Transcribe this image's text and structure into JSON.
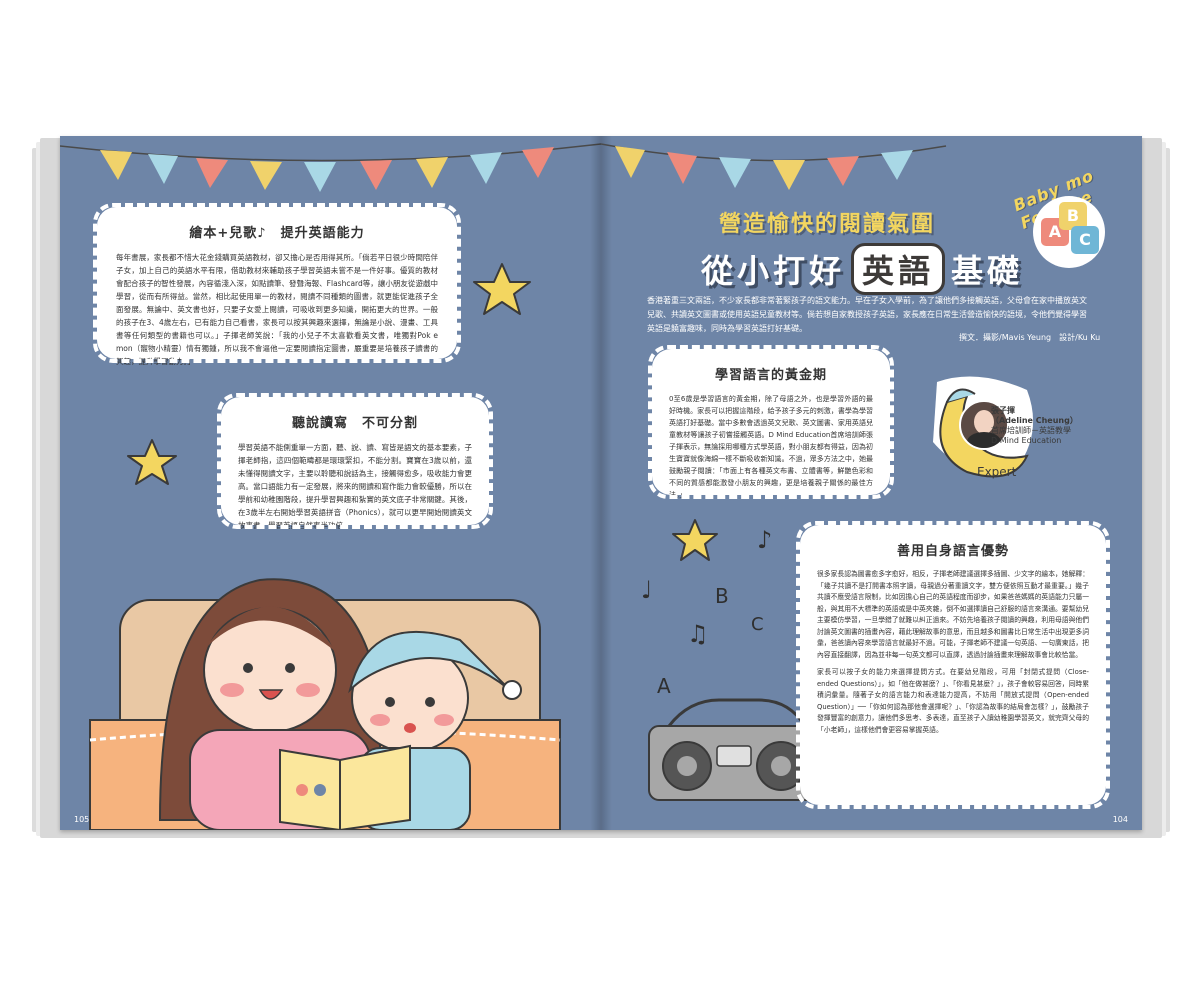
{
  "left_page": {
    "page_number": "105",
    "box1": {
      "title": "繪本+兒歌♪　提升英語能力",
      "text": "每年書展，家長都不惜大花金錢購買英語教材，卻又擔心是否用得其所。「倘若平日很少時間陪伴子女，加上自己的英語水平有限，借助教材來輔助孩子學習英語未嘗不是一件好事。優質的教材會配合孩子的智性發展，內容循淺入深，如點讀筆、發聲海報、Flashcard等，讓小朋友從遊戲中學習，從而有所得益。當然，相比起使用單一的教材，閱讀不同種類的圖書，就更能促進孩子全面發展。無論中、英文書也好，只要子女愛上閱讀，可吸收到更多知識，開拓更大的世界。一般的孩子在3、4歲左右，已有能力自己看書，家長可以按其興趣來選擇，無論是小說、漫畫、工具書等任何類型的書籍也可以。」子揮老師笑說：「我的小兒子不太喜歡看英文書，唯獨對Pok e mon（寵物小精靈）情有獨鍾，所以我不會逼他一定要閱讀指定圖書，嚴重要是培養孩子讀書的興趣，提升學習動力。」"
    },
    "box2": {
      "title": "聽說讀寫　不可分割",
      "text": "學習英語不能側重單一方面，聽、說、讀、寫皆是語文的基本要素，子揮老師指，這四個範疇都是環環緊扣，不能分割。寶寶在3歲以前，還未懂得閱讀文字，主要以聆聽和說話為主，接觸得愈多，吸收能力會更高。當口語能力有一定發展，將來的閱讀和寫作能力會較優勝，所以在學前和幼稚園階段，提升學習興趣和紮實的英文底子非常關鍵。其後，在3歲半左右開始學習英語拼音（Phonics），就可以更早開始閱讀英文故事書，學習英語自然事半功倍。"
    }
  },
  "right_page": {
    "page_number": "104",
    "feature_label": "Baby mo Feature",
    "abc_letters": [
      "A",
      "B",
      "C"
    ],
    "headline_line1": "營造愉快的閱讀氣圍",
    "headline_pre": "從小打好",
    "headline_highlight": "英語",
    "headline_post": "基礎",
    "intro": "香港著重三文兩語，不少家長都非常著緊孩子的語文能力。早在子女入學前，為了讓他們多接觸英語，父母會在家中播放英文兒歌、共讀英文圖書或使用英語兒童教材等。倘若想自家教授孩子英語，家長應在日常生活營造愉快的語境，令他們覺得學習英語是饒富趣味，同時為學習英語打好基礎。",
    "credit": "撰文．攝影/Mavis Yeung　設計/Ku Ku",
    "box3": {
      "title": "學習語言的黃金期",
      "text": "0至6歲是學習語言的黃金期，除了母語之外，也是學習外語的最好時機。家長可以把握這階段，給予孩子多元的刺激，書學為學習英語打好基礎。當中多數會透過英文兒歌、英文圖書、家用英語兒童教材等讓孩子初嘗接觸英語。D Mind Education首席培訓師張子揮表示，無論採用哪種方式學英語，對小朋友都有得益，因為初生寶寶就像海綿一樣不斷吸收新知識。不過，眾多方法之中，她最鼓勵親子閱讀：「市面上有各種英文布書、立體書等，鮮艷色彩和不同的質感都能激發小朋友的興趣，更是培養親子關係的最佳方法。」"
    },
    "expert": {
      "name": "張子揮",
      "name_en": "（Adeline Cheung）",
      "title": "首席培訓師－英語教學",
      "org": "D Mind Education",
      "badge": "Expert"
    },
    "box4": {
      "title": "善用自身語言優勢",
      "text1": "很多家長認為圖書愈多字愈好，相反，子揮老師建議選擇多插圖、少文字的繪本，她解釋：「幾子共讀不是打開書本照字讀，母親過分著重讀文字，雙方便依照互動才最重要。」幾子共讀不應受語言限制，比如因擔心自己的英語程度而卻步，如果爸爸媽媽的英語能力只屬一般，與其用不大標準的英語或是中英夾雜，倒不如選擇讀自己舒服的語言來溝通。要幫幼兒主要模仿學習，一旦學錯了就難以糾正過來。不妨先培養孩子閱讀的興趣，利用母語與他們討論英文圖書的插畫內容，藉此理解故事的意思，而且越多和圖書比日常生活中出現更多詞彙，爸爸讀內容來學習語言就最好不過。可能，子揮老師不建議一句英語、一句廣東話，把內容直接翻譯，因為並非每一句英文都可以直譯，透過討論插畫來理解故事會比較恰當。",
      "text2": "家長可以按子女的能力來選擇提問方式。在要幼兒階段，可用「封閉式提問（Close-ended Questions）」，如「他在做甚麼？」、「你看見甚麼？」，孩子會較容易回答，同時累積詞彙量。隨著子女的語言能力和表達能力提高，不妨用「開放式提問（Open-ended Question）」──「你如何認為那他會選擇呢？」、「你認為故事的結局會怎樣？」，鼓勵孩子發揮豐富的創意力，讓他們多思考、多表達，直至孩子入讀幼稚園學習英文，就完齊父母的「小老師」，這樣他們會更容易掌握英語。"
    }
  },
  "colors": {
    "page_bg": "#6e85a7",
    "flag_yellow": "#f0d26b",
    "flag_blue": "#a9d8e6",
    "flag_red": "#ee8a7c",
    "headline_yellow": "#f3d660"
  },
  "icons": [
    "star-icon",
    "music-note-icon",
    "moon-icon",
    "radio-icon",
    "bunting-icon"
  ]
}
